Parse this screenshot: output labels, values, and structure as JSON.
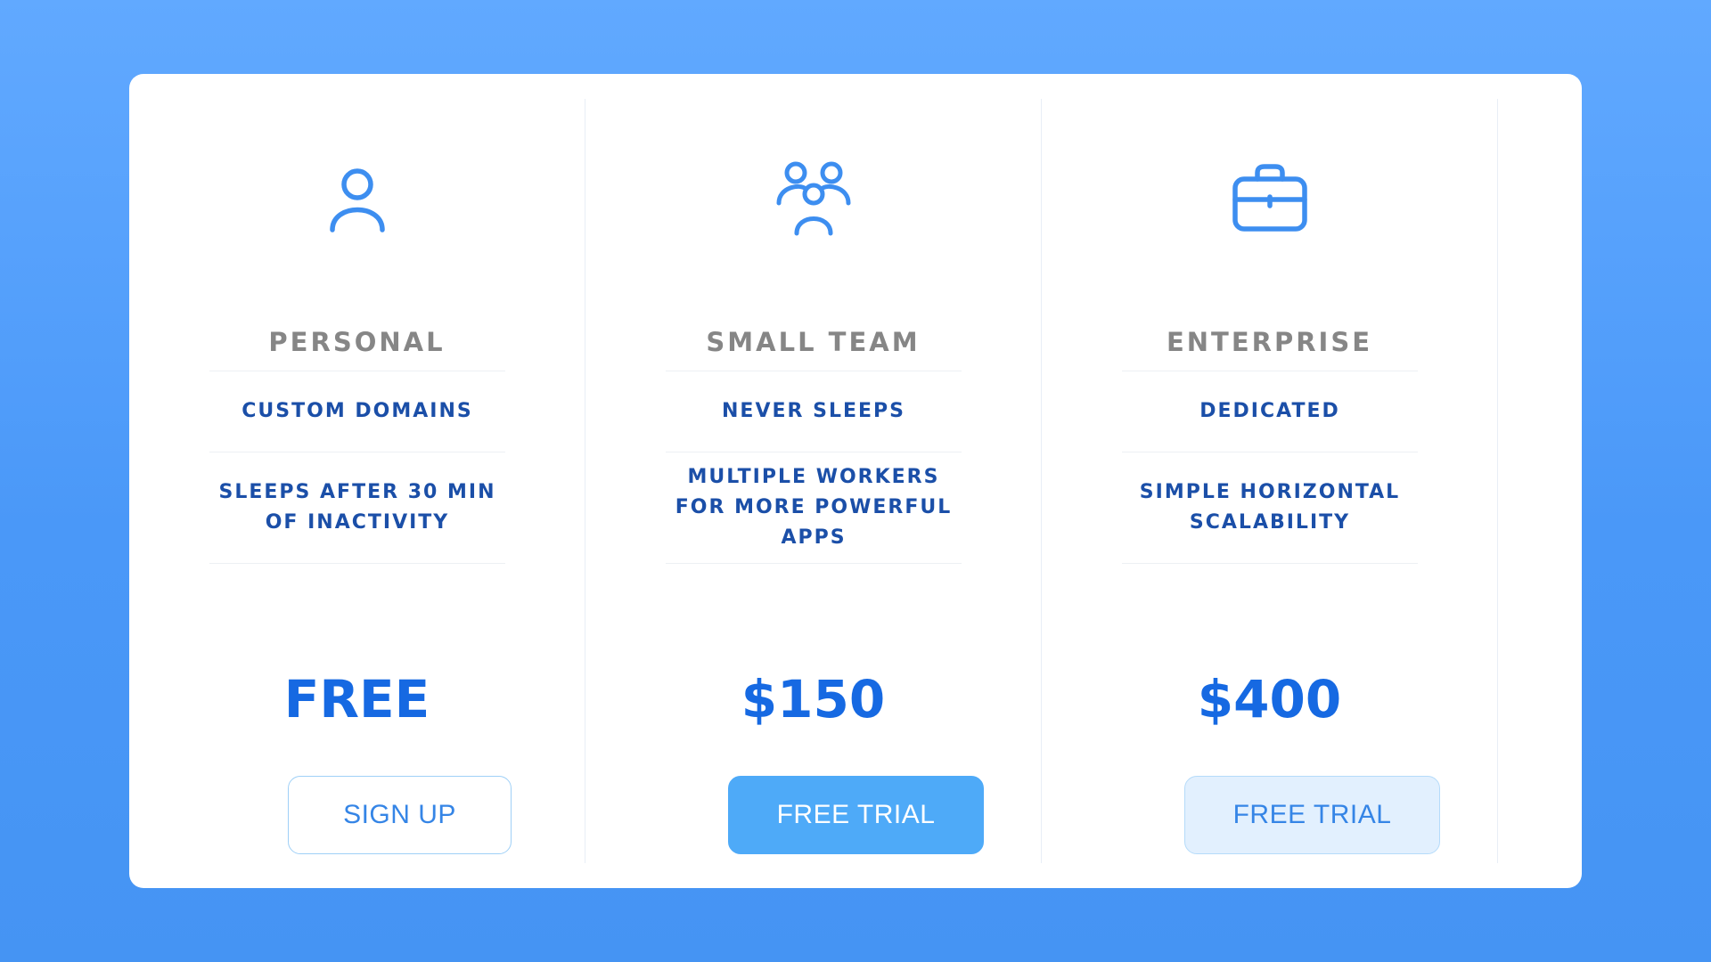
{
  "colors": {
    "background_top": "#61a9ff",
    "background_bottom": "#4594f3",
    "card": "#ffffff",
    "icon": "#3d8ef0",
    "plan_name": "#868686",
    "feature_text": "#1b4fa8",
    "price": "#1669e2",
    "primary_button": "#4eaaf8",
    "light_button": "#e2f0fe"
  },
  "plans": [
    {
      "icon": "user-icon",
      "name": "PERSONAL",
      "features": [
        "CUSTOM DOMAINS",
        "SLEEPS AFTER 30 MIN OF INACTIVITY"
      ],
      "price": "FREE",
      "cta": "SIGN UP"
    },
    {
      "icon": "team-icon",
      "name": "SMALL TEAM",
      "features": [
        "NEVER SLEEPS",
        "MULTIPLE WORKERS FOR MORE POWERFUL APPS"
      ],
      "price": "$150",
      "cta": "FREE TRIAL"
    },
    {
      "icon": "briefcase-icon",
      "name": "ENTERPRISE",
      "features": [
        "DEDICATED",
        "SIMPLE HORIZONTAL SCALABILITY"
      ],
      "price": "$400",
      "cta": "FREE TRIAL"
    }
  ]
}
